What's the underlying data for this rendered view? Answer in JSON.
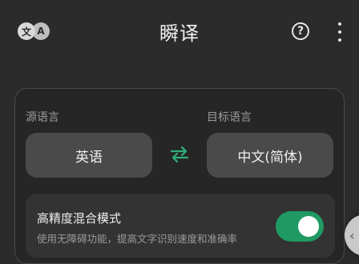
{
  "app": {
    "title": "瞬译",
    "logo_glyph_left": "文",
    "logo_glyph_right": "A"
  },
  "toolbar": {
    "help_icon": "help-circle-icon",
    "help_glyph": "?",
    "menu_icon": "more-vertical-icon"
  },
  "languages": {
    "source_label": "源语言",
    "target_label": "目标语言",
    "source_value": "英语",
    "target_value": "中文(简体)",
    "swap_icon": "swap-arrows-icon",
    "swap_color": "#2fb07a"
  },
  "mode": {
    "title": "高精度混合模式",
    "description": "使用无障碍功能，提高文字识别速度和准确率",
    "enabled": true,
    "toggle_color": "#1f9a63"
  },
  "side_handle": {
    "icon": "chevron-left-icon",
    "glyph": "‹"
  }
}
